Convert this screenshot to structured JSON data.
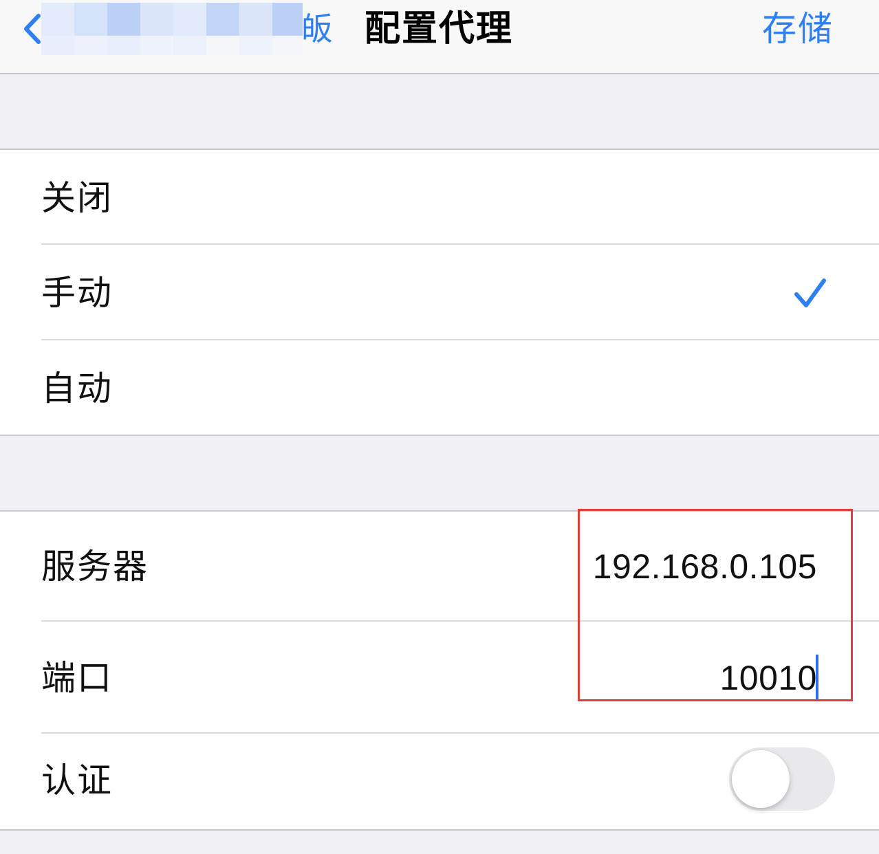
{
  "nav": {
    "back_label_visible": "皈",
    "title": "配置代理",
    "save_label": "存储"
  },
  "proxy_modes": {
    "items": [
      {
        "label": "关闭",
        "selected": false
      },
      {
        "label": "手动",
        "selected": true
      },
      {
        "label": "自动",
        "selected": false
      }
    ]
  },
  "manual_settings": {
    "server_label": "服务器",
    "server_value": "192.168.0.105",
    "port_label": "端口",
    "port_value": "10010",
    "auth_label": "认证",
    "auth_enabled": false
  },
  "colors": {
    "accent": "#2f7ff0",
    "highlight_border": "#e03c3c",
    "background": "#efeff4"
  },
  "icons": {
    "back": "chevron-left-icon",
    "selected": "checkmark-icon"
  }
}
